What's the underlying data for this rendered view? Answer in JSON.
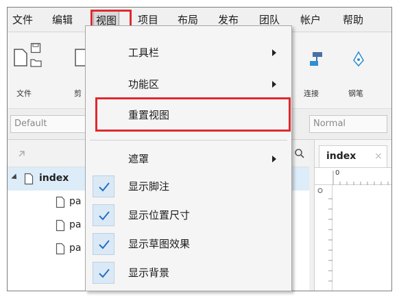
{
  "menubar": {
    "items": [
      "文件",
      "编辑",
      "视图",
      "项目",
      "布局",
      "发布",
      "团队",
      "帐户",
      "帮助"
    ],
    "active_index": 2
  },
  "toolbar": {
    "file_label": "文件",
    "cut_label": "剪",
    "connect_label": "连接",
    "pen_label": "钢笔"
  },
  "stylerow": {
    "left_combo_value": "Default",
    "right_combo_value": "Normal"
  },
  "pages": {
    "root": "index",
    "children": [
      "pa",
      "pa",
      "pa"
    ]
  },
  "editor": {
    "tab_label": "index",
    "ruler_zero": "0"
  },
  "view_menu": {
    "toolbars": "工具栏",
    "ribbon": "功能区",
    "reset_view": "重置视图",
    "mask": "遮罩",
    "show_notes": "显示脚注",
    "show_position_size": "显示位置尺寸",
    "show_sketch_effect": "显示草图效果",
    "show_background": "显示背景"
  },
  "colors": {
    "highlight": "#e0282e",
    "check": "#1f6fc4",
    "selection": "#dcecf8"
  }
}
